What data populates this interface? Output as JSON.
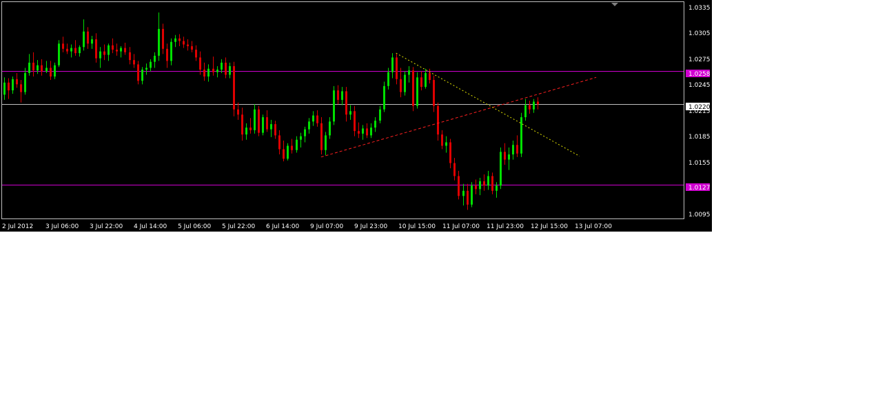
{
  "chart_data": {
    "type": "candlestick",
    "y_ticks": [
      "1.0335",
      "1.0305",
      "1.0275",
      "1.0245",
      "1.0215",
      "1.0185",
      "1.0155",
      "1.0125",
      "1.0095"
    ],
    "ylim": [
      1.0088,
      1.0338
    ],
    "x_ticks": [
      "2 Jul 2012",
      "3 Jul 06:00",
      "3 Jul 22:00",
      "4 Jul 14:00",
      "5 Jul 06:00",
      "5 Jul 22:00",
      "6 Jul 14:00",
      "9 Jul 07:00",
      "9 Jul 23:00",
      "10 Jul 15:00",
      "11 Jul 07:00",
      "11 Jul 23:00",
      "12 Jul 15:00",
      "13 Jul 07:00"
    ],
    "colors": {
      "background": "#000000",
      "up_candle": "#00e000",
      "down_candle": "#e00000",
      "grid_frame": "#c0c0c0",
      "horizontal_level": "#d000d0",
      "bid_line": "#c0c0c0",
      "support_trend": "#ff2020",
      "resistance_trend": "#e6e600"
    },
    "horizontal_levels": [
      {
        "price": 1.0258,
        "label": "1.0258"
      },
      {
        "price": 1.0127,
        "label": "1.0127"
      }
    ],
    "bid": {
      "price": 1.022,
      "label": "1.0220"
    },
    "trendlines": [
      {
        "name": "support",
        "from": [
          1.0159,
          76
        ],
        "to": [
          1.0251,
          142
        ],
        "style": "dashed",
        "color_key": "support_trend"
      },
      {
        "name": "resistance",
        "from": [
          1.0279,
          94
        ],
        "to": [
          1.016,
          138
        ],
        "style": "dotted",
        "color_key": "resistance_trend"
      }
    ],
    "candles": [
      [
        1.0231,
        1.0251,
        1.0225,
        1.0245
      ],
      [
        1.0245,
        1.025,
        1.0226,
        1.0236
      ],
      [
        1.0236,
        1.0252,
        1.0232,
        1.0249
      ],
      [
        1.0249,
        1.0256,
        1.0239,
        1.0243
      ],
      [
        1.0243,
        1.0248,
        1.0222,
        1.0234
      ],
      [
        1.0234,
        1.0262,
        1.0231,
        1.0256
      ],
      [
        1.0256,
        1.0278,
        1.0253,
        1.0268
      ],
      [
        1.0268,
        1.028,
        1.0252,
        1.0259
      ],
      [
        1.0259,
        1.0271,
        1.0255,
        1.0265
      ],
      [
        1.0265,
        1.0272,
        1.0253,
        1.0258
      ],
      [
        1.0258,
        1.027,
        1.0256,
        1.0262
      ],
      [
        1.0262,
        1.027,
        1.0248,
        1.0252
      ],
      [
        1.0252,
        1.0268,
        1.0249,
        1.0265
      ],
      [
        1.0265,
        1.0294,
        1.0263,
        1.029
      ],
      [
        1.029,
        1.0298,
        1.028,
        1.0284
      ],
      [
        1.0284,
        1.029,
        1.0278,
        1.0281
      ],
      [
        1.0281,
        1.0289,
        1.0274,
        1.0285
      ],
      [
        1.0285,
        1.0294,
        1.0276,
        1.0279
      ],
      [
        1.0279,
        1.0288,
        1.0275,
        1.0286
      ],
      [
        1.0286,
        1.0318,
        1.0282,
        1.0304
      ],
      [
        1.0304,
        1.0309,
        1.0284,
        1.029
      ],
      [
        1.029,
        1.0299,
        1.0284,
        1.0295
      ],
      [
        1.0295,
        1.0302,
        1.0268,
        1.0273
      ],
      [
        1.0273,
        1.0286,
        1.0262,
        1.0281
      ],
      [
        1.0281,
        1.0289,
        1.0271,
        1.0277
      ],
      [
        1.0277,
        1.029,
        1.027,
        1.0288
      ],
      [
        1.0288,
        1.0296,
        1.0279,
        1.0283
      ],
      [
        1.0283,
        1.029,
        1.0276,
        1.0281
      ],
      [
        1.0281,
        1.0287,
        1.0274,
        1.0285
      ],
      [
        1.0285,
        1.0291,
        1.0277,
        1.028
      ],
      [
        1.028,
        1.0286,
        1.0266,
        1.0271
      ],
      [
        1.0271,
        1.0278,
        1.0262,
        1.0266
      ],
      [
        1.0266,
        1.027,
        1.0243,
        1.0247
      ],
      [
        1.0247,
        1.0263,
        1.0243,
        1.026
      ],
      [
        1.026,
        1.0267,
        1.0254,
        1.0262
      ],
      [
        1.0262,
        1.0272,
        1.0258,
        1.0269
      ],
      [
        1.0269,
        1.028,
        1.0262,
        1.0276
      ],
      [
        1.0276,
        1.0326,
        1.027,
        1.0307
      ],
      [
        1.0307,
        1.0313,
        1.0278,
        1.0284
      ],
      [
        1.0284,
        1.029,
        1.0262,
        1.027
      ],
      [
        1.027,
        1.0296,
        1.0265,
        1.0292
      ],
      [
        1.0292,
        1.03,
        1.0286,
        1.0296
      ],
      [
        1.0296,
        1.0301,
        1.0287,
        1.0293
      ],
      [
        1.0293,
        1.0298,
        1.0285,
        1.0289
      ],
      [
        1.0289,
        1.0295,
        1.0282,
        1.0287
      ],
      [
        1.0287,
        1.0293,
        1.028,
        1.0283
      ],
      [
        1.0283,
        1.0288,
        1.027,
        1.0274
      ],
      [
        1.0274,
        1.0281,
        1.0254,
        1.026
      ],
      [
        1.026,
        1.0268,
        1.0247,
        1.0252
      ],
      [
        1.0252,
        1.0266,
        1.0246,
        1.0261
      ],
      [
        1.0261,
        1.0275,
        1.0253,
        1.0257
      ],
      [
        1.0257,
        1.0264,
        1.0251,
        1.026
      ],
      [
        1.026,
        1.0272,
        1.0256,
        1.0268
      ],
      [
        1.0268,
        1.0274,
        1.025,
        1.0254
      ],
      [
        1.0254,
        1.0268,
        1.025,
        1.0264
      ],
      [
        1.0264,
        1.0269,
        1.0206,
        1.0214
      ],
      [
        1.0214,
        1.0222,
        1.0202,
        1.0208
      ],
      [
        1.0208,
        1.0216,
        1.0178,
        1.0185
      ],
      [
        1.0185,
        1.0198,
        1.0179,
        1.0193
      ],
      [
        1.0193,
        1.0204,
        1.0186,
        1.019
      ],
      [
        1.019,
        1.022,
        1.0186,
        1.0214
      ],
      [
        1.0214,
        1.0218,
        1.0183,
        1.0187
      ],
      [
        1.0187,
        1.0208,
        1.0184,
        1.0205
      ],
      [
        1.0205,
        1.0213,
        1.0188,
        1.0191
      ],
      [
        1.0191,
        1.0202,
        1.0182,
        1.0197
      ],
      [
        1.0197,
        1.0201,
        1.018,
        1.0184
      ],
      [
        1.0184,
        1.019,
        1.0162,
        1.0168
      ],
      [
        1.0168,
        1.0178,
        1.0154,
        1.0157
      ],
      [
        1.0157,
        1.0175,
        1.0155,
        1.0172
      ],
      [
        1.0172,
        1.018,
        1.0163,
        1.0167
      ],
      [
        1.0167,
        1.0183,
        1.0164,
        1.0179
      ],
      [
        1.0179,
        1.0187,
        1.017,
        1.0183
      ],
      [
        1.0183,
        1.0194,
        1.0176,
        1.0191
      ],
      [
        1.0191,
        1.0204,
        1.0186,
        1.02
      ],
      [
        1.02,
        1.0212,
        1.0195,
        1.0207
      ],
      [
        1.0207,
        1.0213,
        1.0194,
        1.0198
      ],
      [
        1.0198,
        1.0205,
        1.0162,
        1.0167
      ],
      [
        1.0167,
        1.0188,
        1.0161,
        1.0184
      ],
      [
        1.0184,
        1.0205,
        1.018,
        1.02
      ],
      [
        1.02,
        1.0241,
        1.0196,
        1.0236
      ],
      [
        1.0236,
        1.0242,
        1.022,
        1.0225
      ],
      [
        1.0225,
        1.024,
        1.0219,
        1.0235
      ],
      [
        1.0235,
        1.024,
        1.02,
        1.0208
      ],
      [
        1.0208,
        1.0219,
        1.0202,
        1.0212
      ],
      [
        1.0212,
        1.0218,
        1.0183,
        1.0189
      ],
      [
        1.0189,
        1.0199,
        1.0181,
        1.0186
      ],
      [
        1.0186,
        1.0196,
        1.0179,
        1.0192
      ],
      [
        1.0192,
        1.0198,
        1.0181,
        1.0184
      ],
      [
        1.0184,
        1.0198,
        1.0181,
        1.0193
      ],
      [
        1.0193,
        1.0205,
        1.0188,
        1.0201
      ],
      [
        1.0201,
        1.0218,
        1.0198,
        1.0214
      ],
      [
        1.0214,
        1.0246,
        1.0211,
        1.0241
      ],
      [
        1.0241,
        1.0262,
        1.0237,
        1.0257
      ],
      [
        1.0257,
        1.0279,
        1.025,
        1.0274
      ],
      [
        1.0274,
        1.0278,
        1.0243,
        1.0249
      ],
      [
        1.0249,
        1.0262,
        1.0228,
        1.0234
      ],
      [
        1.0234,
        1.0258,
        1.023,
        1.0254
      ],
      [
        1.0254,
        1.0264,
        1.0245,
        1.0259
      ],
      [
        1.0259,
        1.0263,
        1.0212,
        1.0218
      ],
      [
        1.0218,
        1.0257,
        1.0215,
        1.0251
      ],
      [
        1.0251,
        1.0258,
        1.0236,
        1.024
      ],
      [
        1.024,
        1.0261,
        1.0238,
        1.0256
      ],
      [
        1.0256,
        1.0261,
        1.0244,
        1.0248
      ],
      [
        1.0248,
        1.0253,
        1.0211,
        1.0218
      ],
      [
        1.0218,
        1.0222,
        1.0178,
        1.0185
      ],
      [
        1.0185,
        1.019,
        1.0168,
        1.0172
      ],
      [
        1.0172,
        1.0183,
        1.0164,
        1.0176
      ],
      [
        1.0176,
        1.018,
        1.0146,
        1.0152
      ],
      [
        1.0152,
        1.0158,
        1.0132,
        1.0137
      ],
      [
        1.0137,
        1.0143,
        1.011,
        1.0114
      ],
      [
        1.0114,
        1.0128,
        1.0103,
        1.012
      ],
      [
        1.012,
        1.0128,
        1.0098,
        1.0104
      ],
      [
        1.0104,
        1.013,
        1.0101,
        1.0126
      ],
      [
        1.0126,
        1.0133,
        1.0116,
        1.0122
      ],
      [
        1.0122,
        1.0135,
        1.0115,
        1.0131
      ],
      [
        1.0131,
        1.0139,
        1.012,
        1.0126
      ],
      [
        1.0126,
        1.0143,
        1.0121,
        1.0137
      ],
      [
        1.0137,
        1.0141,
        1.0116,
        1.012
      ],
      [
        1.012,
        1.013,
        1.0112,
        1.0126
      ],
      [
        1.0126,
        1.017,
        1.0122,
        1.0165
      ],
      [
        1.0165,
        1.0175,
        1.015,
        1.0156
      ],
      [
        1.0156,
        1.017,
        1.0144,
        1.0162
      ],
      [
        1.0162,
        1.0178,
        1.0156,
        1.0173
      ],
      [
        1.0173,
        1.0184,
        1.0159,
        1.0163
      ],
      [
        1.0163,
        1.021,
        1.0159,
        1.0205
      ],
      [
        1.0205,
        1.0226,
        1.0201,
        1.0219
      ],
      [
        1.0219,
        1.0224,
        1.0209,
        1.0214
      ],
      [
        1.0214,
        1.0226,
        1.021,
        1.0223
      ],
      [
        1.0223,
        1.0228,
        1.0214,
        1.022
      ]
    ]
  }
}
